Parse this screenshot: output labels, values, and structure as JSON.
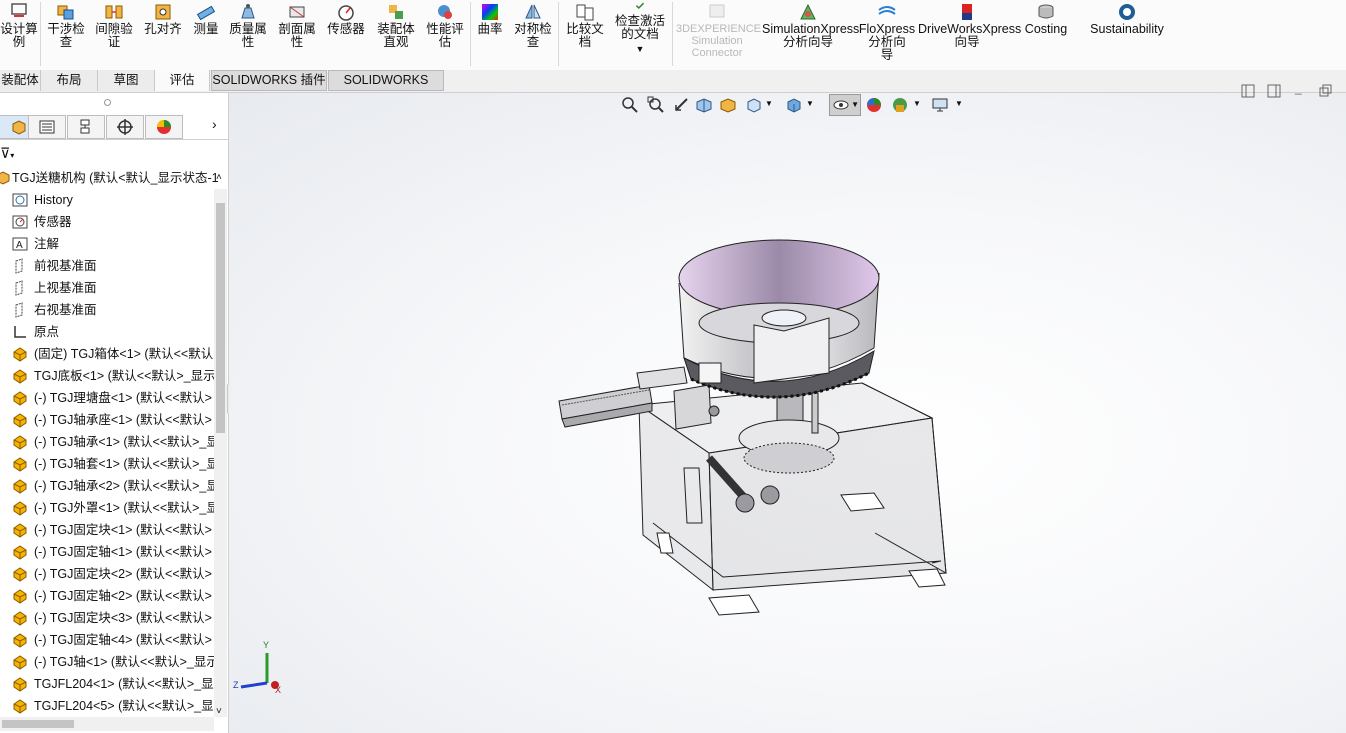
{
  "ribbon": {
    "buttons": [
      {
        "label": "设计算\n例",
        "icon": "design-study-icon"
      },
      {
        "label": "干涉检\n查",
        "icon": "interference-icon"
      },
      {
        "label": "间隙验\n证",
        "icon": "clearance-icon"
      },
      {
        "label": "孔对齐",
        "icon": "hole-align-icon"
      },
      {
        "label": "测量",
        "icon": "measure-icon"
      },
      {
        "label": "质量属\n性",
        "icon": "mass-properties-icon"
      },
      {
        "label": "剖面属\n性",
        "icon": "section-properties-icon"
      },
      {
        "label": "传感器",
        "icon": "sensor-icon"
      },
      {
        "label": "装配体\n直观",
        "icon": "assembly-visual-icon"
      },
      {
        "label": "性能评\n估",
        "icon": "performance-icon"
      },
      {
        "label": "曲率",
        "icon": "curvature-icon"
      },
      {
        "label": "对称检\n查",
        "icon": "symmetry-icon"
      },
      {
        "label": "比较文\n档",
        "icon": "compare-icon"
      },
      {
        "label": "检查激活\n的文档",
        "icon": "check-doc-icon"
      },
      {
        "label": "3DEXPERIENCE\nSimulation\nConnector",
        "icon": "3dexperience-icon"
      },
      {
        "label": "SimulationXpress\n分析向导",
        "icon": "simulationxpress-icon"
      },
      {
        "label": "FloXpress\n分析向\n导",
        "icon": "floxpress-icon"
      },
      {
        "label": "DriveWorksXpress\n向导",
        "icon": "driveworks-icon"
      },
      {
        "label": "Costing",
        "icon": "costing-icon"
      },
      {
        "label": "Sustainability",
        "icon": "sustainability-icon"
      }
    ]
  },
  "tabs": [
    "装配体",
    "布局",
    "草图",
    "评估",
    "SOLIDWORKS 插件",
    "SOLIDWORKS MBD"
  ],
  "tree": {
    "root": "TGJ送糖机构  (默认<默认_显示状态-1",
    "items": [
      {
        "label": "History",
        "icon": "history-icon"
      },
      {
        "label": "传感器",
        "icon": "sensor-icon"
      },
      {
        "label": "注解",
        "icon": "annotation-icon"
      },
      {
        "label": "前视基准面",
        "icon": "plane-icon"
      },
      {
        "label": "上视基准面",
        "icon": "plane-icon"
      },
      {
        "label": "右视基准面",
        "icon": "plane-icon"
      },
      {
        "label": "原点",
        "icon": "origin-icon"
      },
      {
        "label": "(固定) TGJ箱体<1> (默认<<默认",
        "icon": "part-icon"
      },
      {
        "label": "TGJ底板<1> (默认<<默认>_显示",
        "icon": "part-icon"
      },
      {
        "label": "(-) TGJ理塘盘<1> (默认<<默认>",
        "icon": "part-icon"
      },
      {
        "label": "(-) TGJ轴承座<1> (默认<<默认>",
        "icon": "part-icon"
      },
      {
        "label": "(-) TGJ轴承<1> (默认<<默认>_显",
        "icon": "part-icon"
      },
      {
        "label": "(-) TGJ轴套<1> (默认<<默认>_显",
        "icon": "part-icon"
      },
      {
        "label": "(-) TGJ轴承<2> (默认<<默认>_显",
        "icon": "part-icon"
      },
      {
        "label": "(-) TGJ外罩<1> (默认<<默认>_显",
        "icon": "part-icon"
      },
      {
        "label": "(-) TGJ固定块<1> (默认<<默认>",
        "icon": "part-icon"
      },
      {
        "label": "(-) TGJ固定轴<1> (默认<<默认>",
        "icon": "part-icon"
      },
      {
        "label": "(-) TGJ固定块<2> (默认<<默认>",
        "icon": "part-icon"
      },
      {
        "label": "(-) TGJ固定轴<2> (默认<<默认>",
        "icon": "part-icon"
      },
      {
        "label": "(-) TGJ固定块<3> (默认<<默认>",
        "icon": "part-icon"
      },
      {
        "label": "(-) TGJ固定轴<4> (默认<<默认>",
        "icon": "part-icon"
      },
      {
        "label": "(-) TGJ轴<1> (默认<<默认>_显示",
        "icon": "part-icon"
      },
      {
        "label": "TGJFL204<1> (默认<<默认>_显",
        "icon": "part-icon"
      },
      {
        "label": "TGJFL204<5> (默认<<默认>_显",
        "icon": "part-icon"
      }
    ]
  },
  "triad": {
    "x": "X",
    "y": "Y",
    "z": "Z"
  },
  "colors": {
    "accent": "#f4b400",
    "panel_selected": "#dbe8f6"
  }
}
